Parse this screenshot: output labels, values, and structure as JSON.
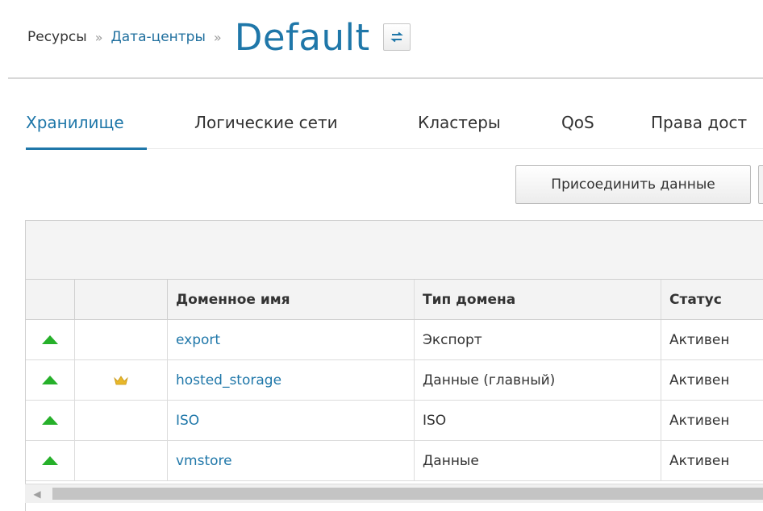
{
  "breadcrumb": {
    "root": "Ресурсы",
    "separator": "»",
    "parent": "Дата-центры",
    "title": "Default"
  },
  "header": {
    "switch_icon": "swap-arrows-icon"
  },
  "tabs": [
    {
      "label": "Хранилище",
      "active": true
    },
    {
      "label": "Логические сети",
      "active": false
    },
    {
      "label": "Кластеры",
      "active": false
    },
    {
      "label": "QoS",
      "active": false
    },
    {
      "label": "Права дост",
      "active": false
    }
  ],
  "toolbar": {
    "attach_label": "Присоединить данные"
  },
  "table": {
    "columns": [
      "",
      "",
      "Доменное имя",
      "Тип домена",
      "Статус"
    ],
    "rows": [
      {
        "status_icon": "up-arrow-icon",
        "master_icon": "",
        "name": "export",
        "type": "Экспорт",
        "status": "Активен"
      },
      {
        "status_icon": "up-arrow-icon",
        "master_icon": "crown-icon",
        "name": "hosted_storage",
        "type": "Данные (главный)",
        "status": "Активен"
      },
      {
        "status_icon": "up-arrow-icon",
        "master_icon": "",
        "name": "ISO",
        "type": "ISO",
        "status": "Активен"
      },
      {
        "status_icon": "up-arrow-icon",
        "master_icon": "",
        "name": "vmstore",
        "type": "Данные",
        "status": "Активен"
      }
    ]
  },
  "colors": {
    "accent": "#1f77a9",
    "status_up": "#26b02a",
    "crown": "#e8b82a"
  }
}
